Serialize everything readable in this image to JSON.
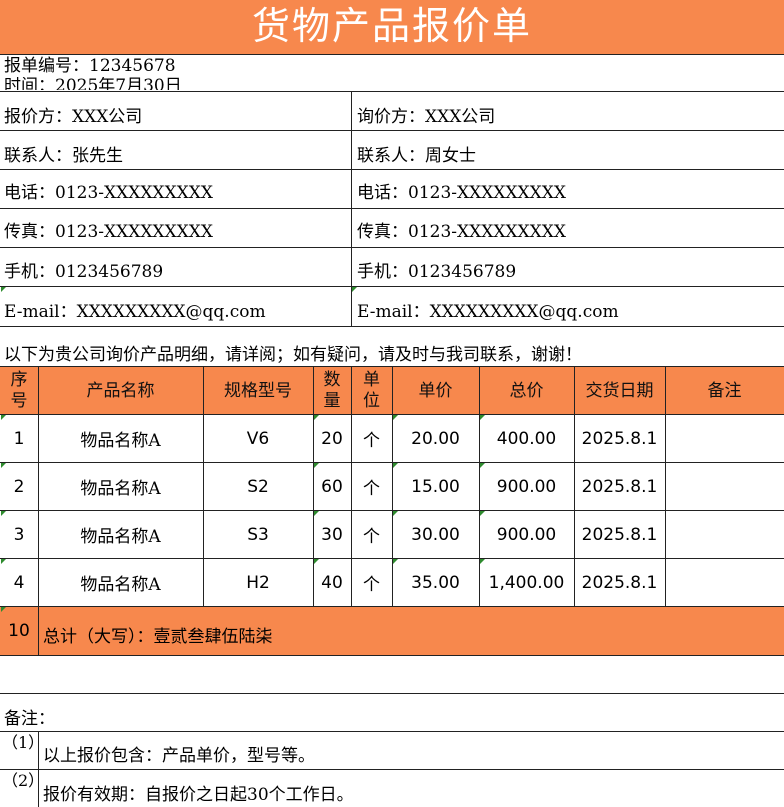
{
  "title": "货物产品报价单",
  "meta": {
    "quote_no": "报单编号：12345678",
    "date": "时间：2025年7月30日"
  },
  "info": {
    "left": [
      "报价方：XXX公司",
      "联系人：张先生",
      "电话：0123-XXXXXXXXX",
      "传真：0123-XXXXXXXXX",
      "手机：0123456789",
      "E-mail：XXXXXXXXX@qq.com"
    ],
    "right": [
      "询价方：XXX公司",
      "联系人：周女士",
      "电话：0123-XXXXXXXXX",
      "传真：0123-XXXXXXXXX",
      "手机：0123456789",
      "E-mail：XXXXXXXXX@qq.com"
    ]
  },
  "intro": "以下为贵公司询价产品明细，请详阅；如有疑问，请及时与我司联系，谢谢！",
  "table": {
    "headers": {
      "seq": "序号",
      "name": "产品名称",
      "model": "规格型号",
      "qty": "数量",
      "unit": "单位",
      "price": "单价",
      "total": "总价",
      "delivery": "交货日期",
      "remark": "备注"
    },
    "rows": [
      {
        "seq": "1",
        "name": "物品名称A",
        "model": "V6",
        "qty": "20",
        "unit": "个",
        "price": "20.00",
        "total": "400.00",
        "delivery": "2025.8.1",
        "remark": ""
      },
      {
        "seq": "2",
        "name": "物品名称A",
        "model": "S2",
        "qty": "60",
        "unit": "个",
        "price": "15.00",
        "total": "900.00",
        "delivery": "2025.8.1",
        "remark": ""
      },
      {
        "seq": "3",
        "name": "物品名称A",
        "model": "S3",
        "qty": "30",
        "unit": "个",
        "price": "30.00",
        "total": "900.00",
        "delivery": "2025.8.1",
        "remark": ""
      },
      {
        "seq": "4",
        "name": "物品名称A",
        "model": "H2",
        "qty": "40",
        "unit": "个",
        "price": "35.00",
        "total": "1,400.00",
        "delivery": "2025.8.1",
        "remark": ""
      }
    ],
    "total": {
      "seq": "10",
      "label": "总计（大写）：壹贰叁肆伍陆柒"
    }
  },
  "notes": {
    "heading": "备注：",
    "items": [
      {
        "num": "（1）",
        "text": "以上报价包含：产品单价，型号等。"
      },
      {
        "num": "（2）",
        "text": "报价有效期：自报价之日起30个工作日。"
      }
    ]
  },
  "colors": {
    "accent": "#f7884d",
    "marker": "#2e8b2e"
  }
}
